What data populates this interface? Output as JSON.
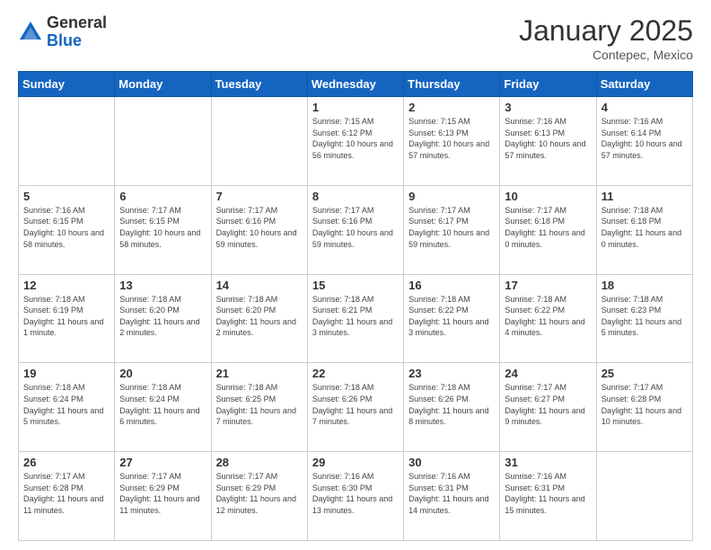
{
  "header": {
    "logo_general": "General",
    "logo_blue": "Blue",
    "month_title": "January 2025",
    "subtitle": "Contepec, Mexico"
  },
  "days_of_week": [
    "Sunday",
    "Monday",
    "Tuesday",
    "Wednesday",
    "Thursday",
    "Friday",
    "Saturday"
  ],
  "weeks": [
    [
      {
        "day": "",
        "info": ""
      },
      {
        "day": "",
        "info": ""
      },
      {
        "day": "",
        "info": ""
      },
      {
        "day": "1",
        "info": "Sunrise: 7:15 AM\nSunset: 6:12 PM\nDaylight: 10 hours and 56 minutes."
      },
      {
        "day": "2",
        "info": "Sunrise: 7:15 AM\nSunset: 6:13 PM\nDaylight: 10 hours and 57 minutes."
      },
      {
        "day": "3",
        "info": "Sunrise: 7:16 AM\nSunset: 6:13 PM\nDaylight: 10 hours and 57 minutes."
      },
      {
        "day": "4",
        "info": "Sunrise: 7:16 AM\nSunset: 6:14 PM\nDaylight: 10 hours and 57 minutes."
      }
    ],
    [
      {
        "day": "5",
        "info": "Sunrise: 7:16 AM\nSunset: 6:15 PM\nDaylight: 10 hours and 58 minutes."
      },
      {
        "day": "6",
        "info": "Sunrise: 7:17 AM\nSunset: 6:15 PM\nDaylight: 10 hours and 58 minutes."
      },
      {
        "day": "7",
        "info": "Sunrise: 7:17 AM\nSunset: 6:16 PM\nDaylight: 10 hours and 59 minutes."
      },
      {
        "day": "8",
        "info": "Sunrise: 7:17 AM\nSunset: 6:16 PM\nDaylight: 10 hours and 59 minutes."
      },
      {
        "day": "9",
        "info": "Sunrise: 7:17 AM\nSunset: 6:17 PM\nDaylight: 10 hours and 59 minutes."
      },
      {
        "day": "10",
        "info": "Sunrise: 7:17 AM\nSunset: 6:18 PM\nDaylight: 11 hours and 0 minutes."
      },
      {
        "day": "11",
        "info": "Sunrise: 7:18 AM\nSunset: 6:18 PM\nDaylight: 11 hours and 0 minutes."
      }
    ],
    [
      {
        "day": "12",
        "info": "Sunrise: 7:18 AM\nSunset: 6:19 PM\nDaylight: 11 hours and 1 minute."
      },
      {
        "day": "13",
        "info": "Sunrise: 7:18 AM\nSunset: 6:20 PM\nDaylight: 11 hours and 2 minutes."
      },
      {
        "day": "14",
        "info": "Sunrise: 7:18 AM\nSunset: 6:20 PM\nDaylight: 11 hours and 2 minutes."
      },
      {
        "day": "15",
        "info": "Sunrise: 7:18 AM\nSunset: 6:21 PM\nDaylight: 11 hours and 3 minutes."
      },
      {
        "day": "16",
        "info": "Sunrise: 7:18 AM\nSunset: 6:22 PM\nDaylight: 11 hours and 3 minutes."
      },
      {
        "day": "17",
        "info": "Sunrise: 7:18 AM\nSunset: 6:22 PM\nDaylight: 11 hours and 4 minutes."
      },
      {
        "day": "18",
        "info": "Sunrise: 7:18 AM\nSunset: 6:23 PM\nDaylight: 11 hours and 5 minutes."
      }
    ],
    [
      {
        "day": "19",
        "info": "Sunrise: 7:18 AM\nSunset: 6:24 PM\nDaylight: 11 hours and 5 minutes."
      },
      {
        "day": "20",
        "info": "Sunrise: 7:18 AM\nSunset: 6:24 PM\nDaylight: 11 hours and 6 minutes."
      },
      {
        "day": "21",
        "info": "Sunrise: 7:18 AM\nSunset: 6:25 PM\nDaylight: 11 hours and 7 minutes."
      },
      {
        "day": "22",
        "info": "Sunrise: 7:18 AM\nSunset: 6:26 PM\nDaylight: 11 hours and 7 minutes."
      },
      {
        "day": "23",
        "info": "Sunrise: 7:18 AM\nSunset: 6:26 PM\nDaylight: 11 hours and 8 minutes."
      },
      {
        "day": "24",
        "info": "Sunrise: 7:17 AM\nSunset: 6:27 PM\nDaylight: 11 hours and 9 minutes."
      },
      {
        "day": "25",
        "info": "Sunrise: 7:17 AM\nSunset: 6:28 PM\nDaylight: 11 hours and 10 minutes."
      }
    ],
    [
      {
        "day": "26",
        "info": "Sunrise: 7:17 AM\nSunset: 6:28 PM\nDaylight: 11 hours and 11 minutes."
      },
      {
        "day": "27",
        "info": "Sunrise: 7:17 AM\nSunset: 6:29 PM\nDaylight: 11 hours and 11 minutes."
      },
      {
        "day": "28",
        "info": "Sunrise: 7:17 AM\nSunset: 6:29 PM\nDaylight: 11 hours and 12 minutes."
      },
      {
        "day": "29",
        "info": "Sunrise: 7:16 AM\nSunset: 6:30 PM\nDaylight: 11 hours and 13 minutes."
      },
      {
        "day": "30",
        "info": "Sunrise: 7:16 AM\nSunset: 6:31 PM\nDaylight: 11 hours and 14 minutes."
      },
      {
        "day": "31",
        "info": "Sunrise: 7:16 AM\nSunset: 6:31 PM\nDaylight: 11 hours and 15 minutes."
      },
      {
        "day": "",
        "info": ""
      }
    ]
  ]
}
